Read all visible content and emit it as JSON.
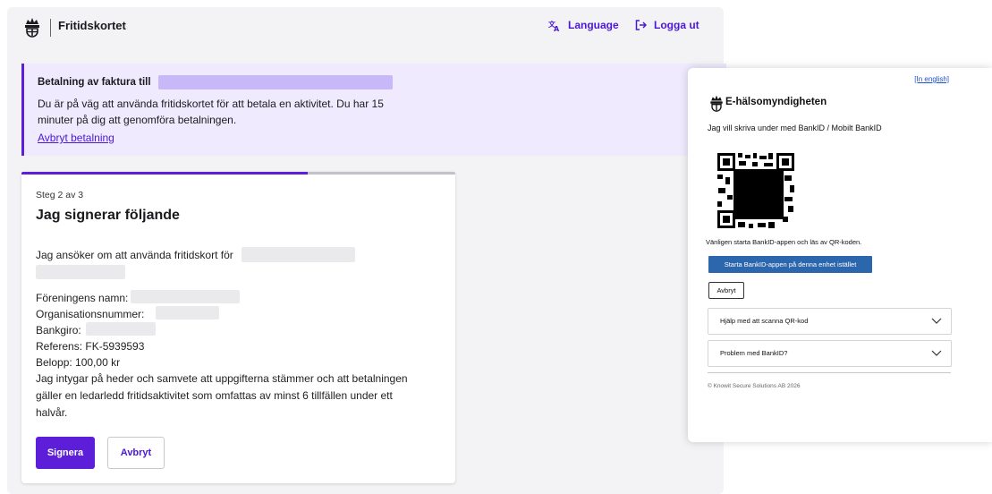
{
  "header": {
    "app_name": "Fritidskortet",
    "language_label": "Language",
    "logout_label": "Logga ut",
    "accent_color": "#5c1ed8"
  },
  "banner": {
    "title": "Betalning av faktura till",
    "description": "Du är på väg att använda fritidskortet för att betala en aktivitet. Du har 15 minuter på dig att genomföra betalningen.",
    "cancel_link": "Avbryt betalning"
  },
  "signing": {
    "step": "Steg 2 av 3",
    "progress_percent": 66,
    "title": "Jag signerar följande",
    "intro": "Jag ansöker om att använda fritidskort för",
    "association_label": "Föreningens namn:",
    "org_number_label": "Organisationsnummer:",
    "bankgiro_label": "Bankgiro:",
    "reference": "Referens: FK-5939593",
    "amount": "Belopp: 100,00 kr",
    "attestation": "Jag intygar på heder och samvete att uppgifterna stämmer och att betalningen gäller en ledarledd fritidsaktivitet som omfattas av minst 6 tillfällen under ett halvår.",
    "sign_button": "Signera",
    "cancel_button": "Avbryt"
  },
  "bankid": {
    "language_link": "[In english]",
    "org_name": "E-hälsomyndigheten",
    "heading": "Jag vill skriva under med BankID / Mobilt BankID",
    "qr_hint": "Vänligen starta BankID-appen och läs av QR-koden.",
    "start_app_button": "Starta BankID-appen på denna enhet istället",
    "cancel_button": "Avbryt",
    "help_items": [
      "Hjälp med att scanna QR-kod",
      "Problem med BankID?"
    ],
    "copyright": "© Knowit Secure Solutions AB 2026",
    "button_color": "#2c67ad"
  },
  "icons": {
    "logo": "crown-emblem-icon",
    "language": "translate-icon",
    "logout": "logout-arrow-icon",
    "chevron": "chevron-down-icon"
  }
}
